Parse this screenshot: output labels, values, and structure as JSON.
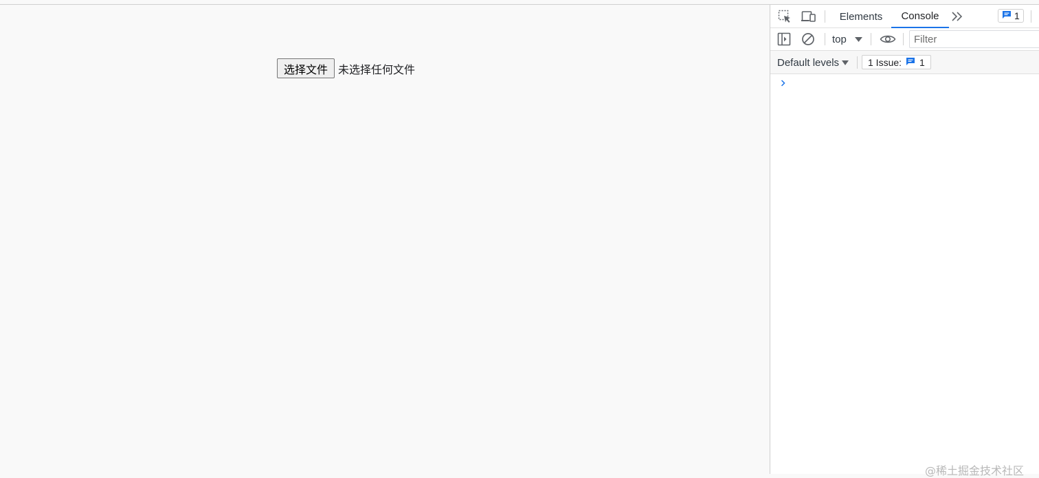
{
  "page": {
    "file_button_label": "选择文件",
    "file_status": "未选择任何文件"
  },
  "devtools": {
    "tabs": [
      {
        "label": "Elements",
        "active": false
      },
      {
        "label": "Console",
        "active": true
      }
    ],
    "message_badge_count": "1",
    "context": "top",
    "filter_placeholder": "Filter",
    "levels_label": "Default levels",
    "issues_label": "1 Issue:",
    "issues_count": "1",
    "accent_color": "#1a73e8"
  },
  "watermark": "@稀土掘金技术社区",
  "icons": [
    "inspect-element-icon",
    "device-toolbar-icon",
    "more-tabs-icon",
    "message-icon",
    "sidebar-toggle-icon",
    "clear-console-icon",
    "dropdown-arrow-icon",
    "eye-icon",
    "prompt-chevron-icon"
  ]
}
